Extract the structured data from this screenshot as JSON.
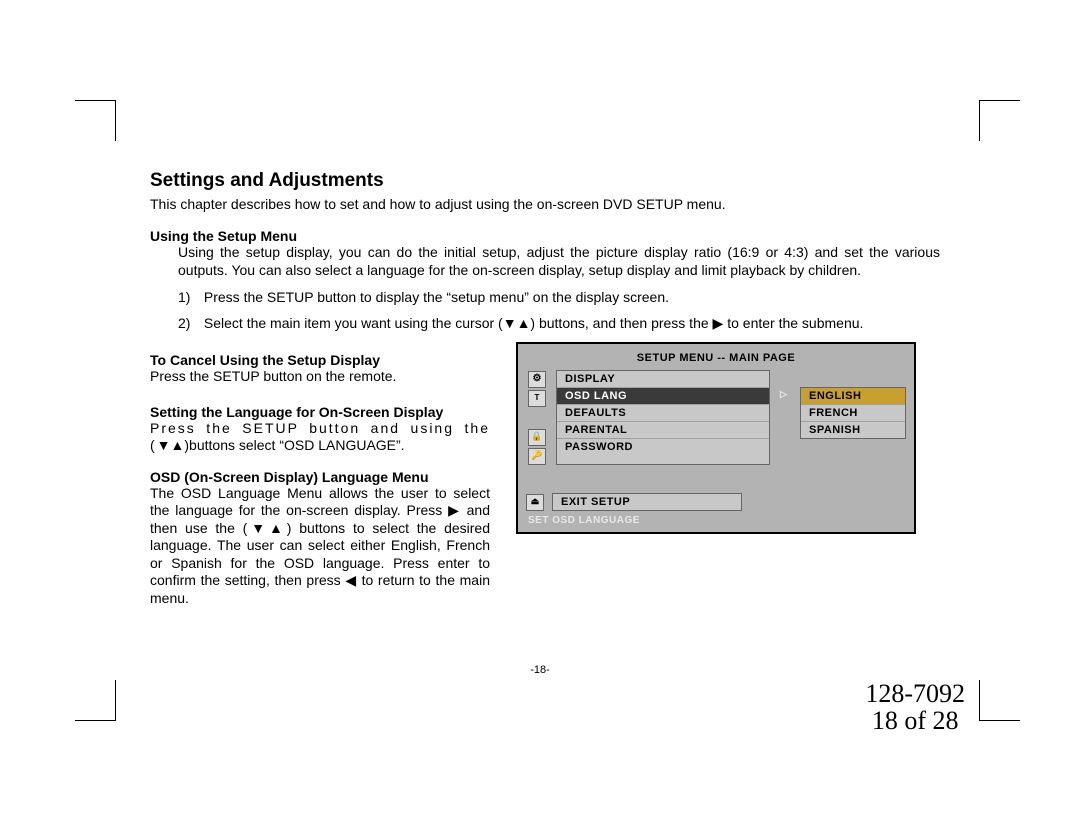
{
  "heading": "Settings and Adjustments",
  "intro": "This chapter describes how to set and how to adjust using the on-screen DVD SETUP menu.",
  "section1": {
    "title": "Using the Setup Menu",
    "body": "Using the setup display, you can do the initial setup, adjust the picture display ratio (16:9 or 4:3) and set the various outputs.  You can also select a language for the on-screen display, setup display and limit playback by children.",
    "step1_num": "1)",
    "step1": "Press the SETUP button to display the “setup menu” on the display screen.",
    "step2_num": "2)",
    "step2a": "Select the main item you want using the cursor (",
    "step2b": ") buttons, and then press the ",
    "step2c": " to enter the submenu."
  },
  "section2": {
    "title": "To Cancel Using the Setup Display",
    "body": "Press the SETUP button on the remote."
  },
  "section3": {
    "title": "Setting the Language for On-Screen Display",
    "line1a": "Press the SETUP button and using the (",
    "line1b": ")buttons select “OSD LANGUAGE”."
  },
  "section4": {
    "title": "OSD (On-Screen Display) Language Menu",
    "p1a": "The OSD Language Menu allows the user to select the language for the on-screen display.  Press ",
    "p1b": " and then use the (",
    "p1c": ") buttons to select the desired language.  The user can select either English, French or Spanish for the OSD language.  Press enter to confirm the setting, then press ",
    "p1d": " to return to the main menu."
  },
  "osd": {
    "title": "SETUP MENU -- MAIN PAGE",
    "items": [
      "DISPLAY",
      "OSD LANG",
      "DEFAULTS",
      "PARENTAL",
      "PASSWORD"
    ],
    "sub": [
      "ENGLISH",
      "FRENCH",
      "SPANISH"
    ],
    "exit": "EXIT SETUP",
    "status": "SET OSD LANGUAGE"
  },
  "glyphs": {
    "down": "▼",
    "up": "▲",
    "right": "▶",
    "left": "◀",
    "right_outline": "▷"
  },
  "pagenum_mid": "-18-",
  "docnum": "128-7092",
  "pagenum": "18 of 28"
}
